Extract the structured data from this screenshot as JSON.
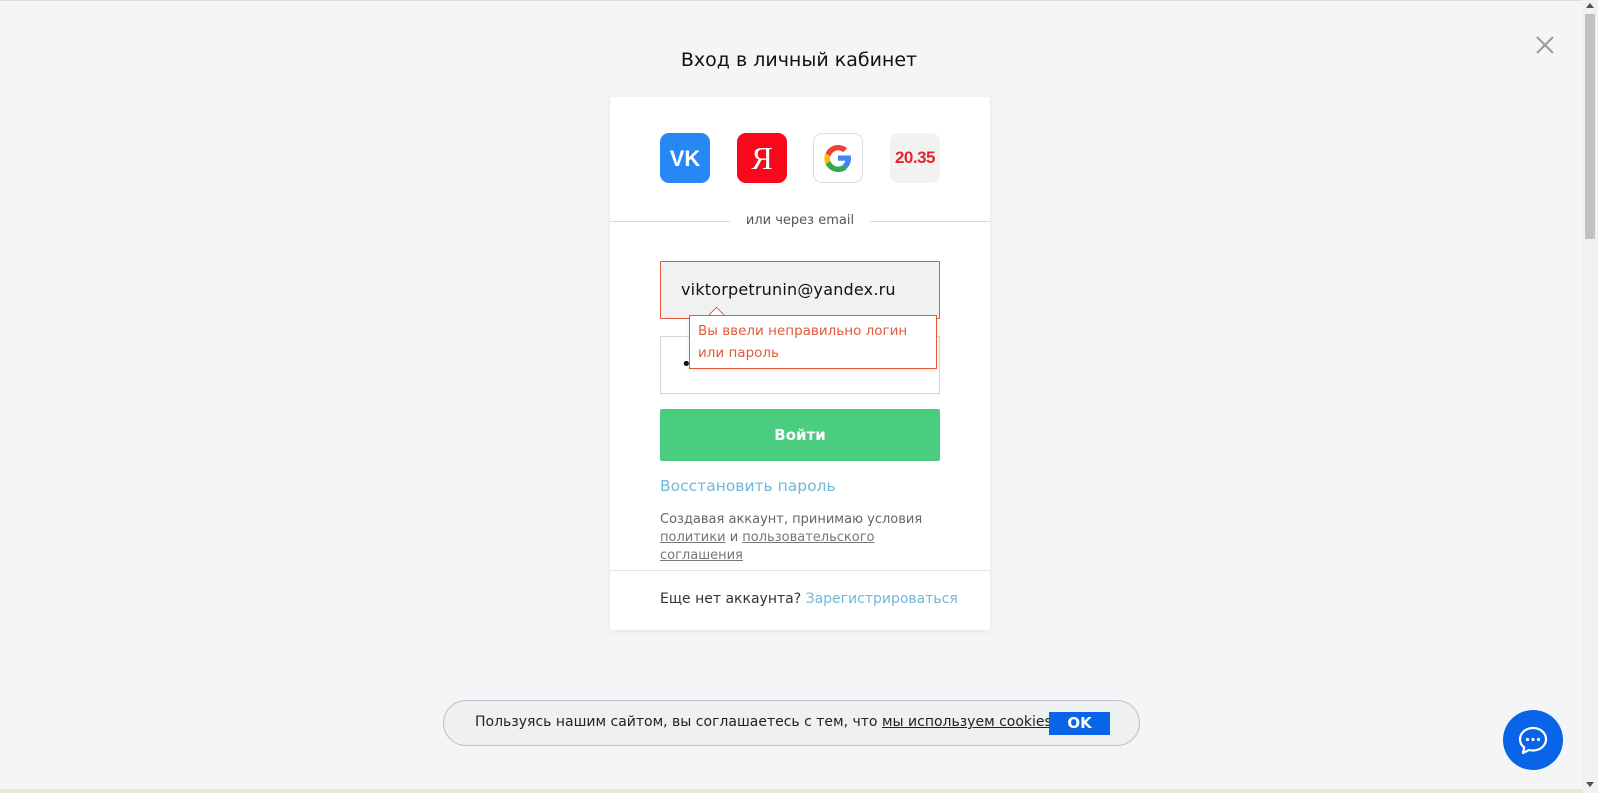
{
  "page": {
    "title": "Вход в личный кабинет",
    "close_icon": "close-icon"
  },
  "social": {
    "providers": [
      {
        "name": "vk",
        "icon": "vk-logo-icon",
        "color": "#2787f5"
      },
      {
        "name": "yandex",
        "label": "Я",
        "icon": "yandex-logo-icon",
        "color": "#f8081a"
      },
      {
        "name": "google",
        "icon": "google-logo-icon"
      },
      {
        "name": "2035",
        "label": "20.35",
        "icon": "university-2035-logo-icon",
        "color": "#e3262f"
      }
    ],
    "divider_text": "или через email"
  },
  "form": {
    "email_value": "viktorpetrunin@yandex.ru",
    "password_masked": "•",
    "error_message": "Вы ввели неправильно логин или пароль",
    "login_label": "Войти",
    "restore_label": "Восстановить пароль",
    "terms_text": "Создавая аккаунт, принимаю условия",
    "terms_policy_link": "политики",
    "terms_and": "и",
    "terms_agreement_link": "пользовательского соглашения"
  },
  "footer": {
    "no_account_text": "Еще нет аккаунта?",
    "register_label": "Зарегистрироваться"
  },
  "cookie": {
    "text": "Пользуясь нашим сайтом, вы соглашаетесь с тем, что",
    "link": "мы используем cookies",
    "ok_label": "OK"
  },
  "chat": {
    "icon": "chat-bubble-icon"
  },
  "colors": {
    "accent_green": "#4bcd80",
    "link_blue": "#6fb8db",
    "error_red": "#e25a3c",
    "primary_blue": "#0a64e8"
  }
}
